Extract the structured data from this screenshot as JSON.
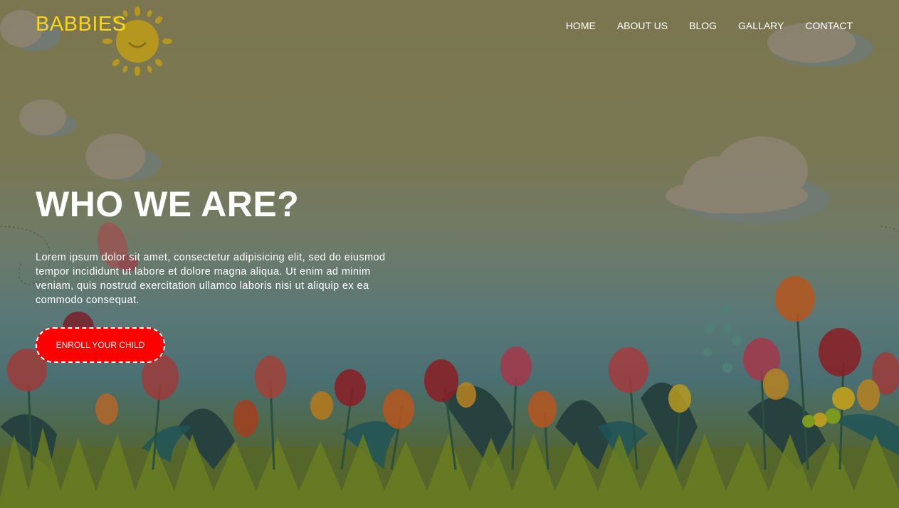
{
  "header": {
    "logo": "BABBIES",
    "nav": [
      "HOME",
      "ABOUT US",
      "BLOG",
      "GALLARY",
      "CONTACT"
    ]
  },
  "hero": {
    "title": "WHO WE ARE?",
    "body": "Lorem ipsum dolor sit amet, consectetur adipisicing elit, sed do eiusmod tempor incididunt ut labore et dolore magna aliqua. Ut enim ad minim veniam, quis nostrud exercitation ullamco laboris nisi ut aliquip ex ea commodo consequat.",
    "cta": "ENROLL YOUR CHILD"
  },
  "colors": {
    "logo": "#f7d51d",
    "cta": "#ff0000",
    "overlay": "#7b7650"
  },
  "background": {
    "illustration": "children-garden-scene",
    "icons": [
      "sun-icon",
      "cloud-icon",
      "tulip-icon",
      "butterfly-icon",
      "caterpillar-icon",
      "grass-icon"
    ]
  }
}
